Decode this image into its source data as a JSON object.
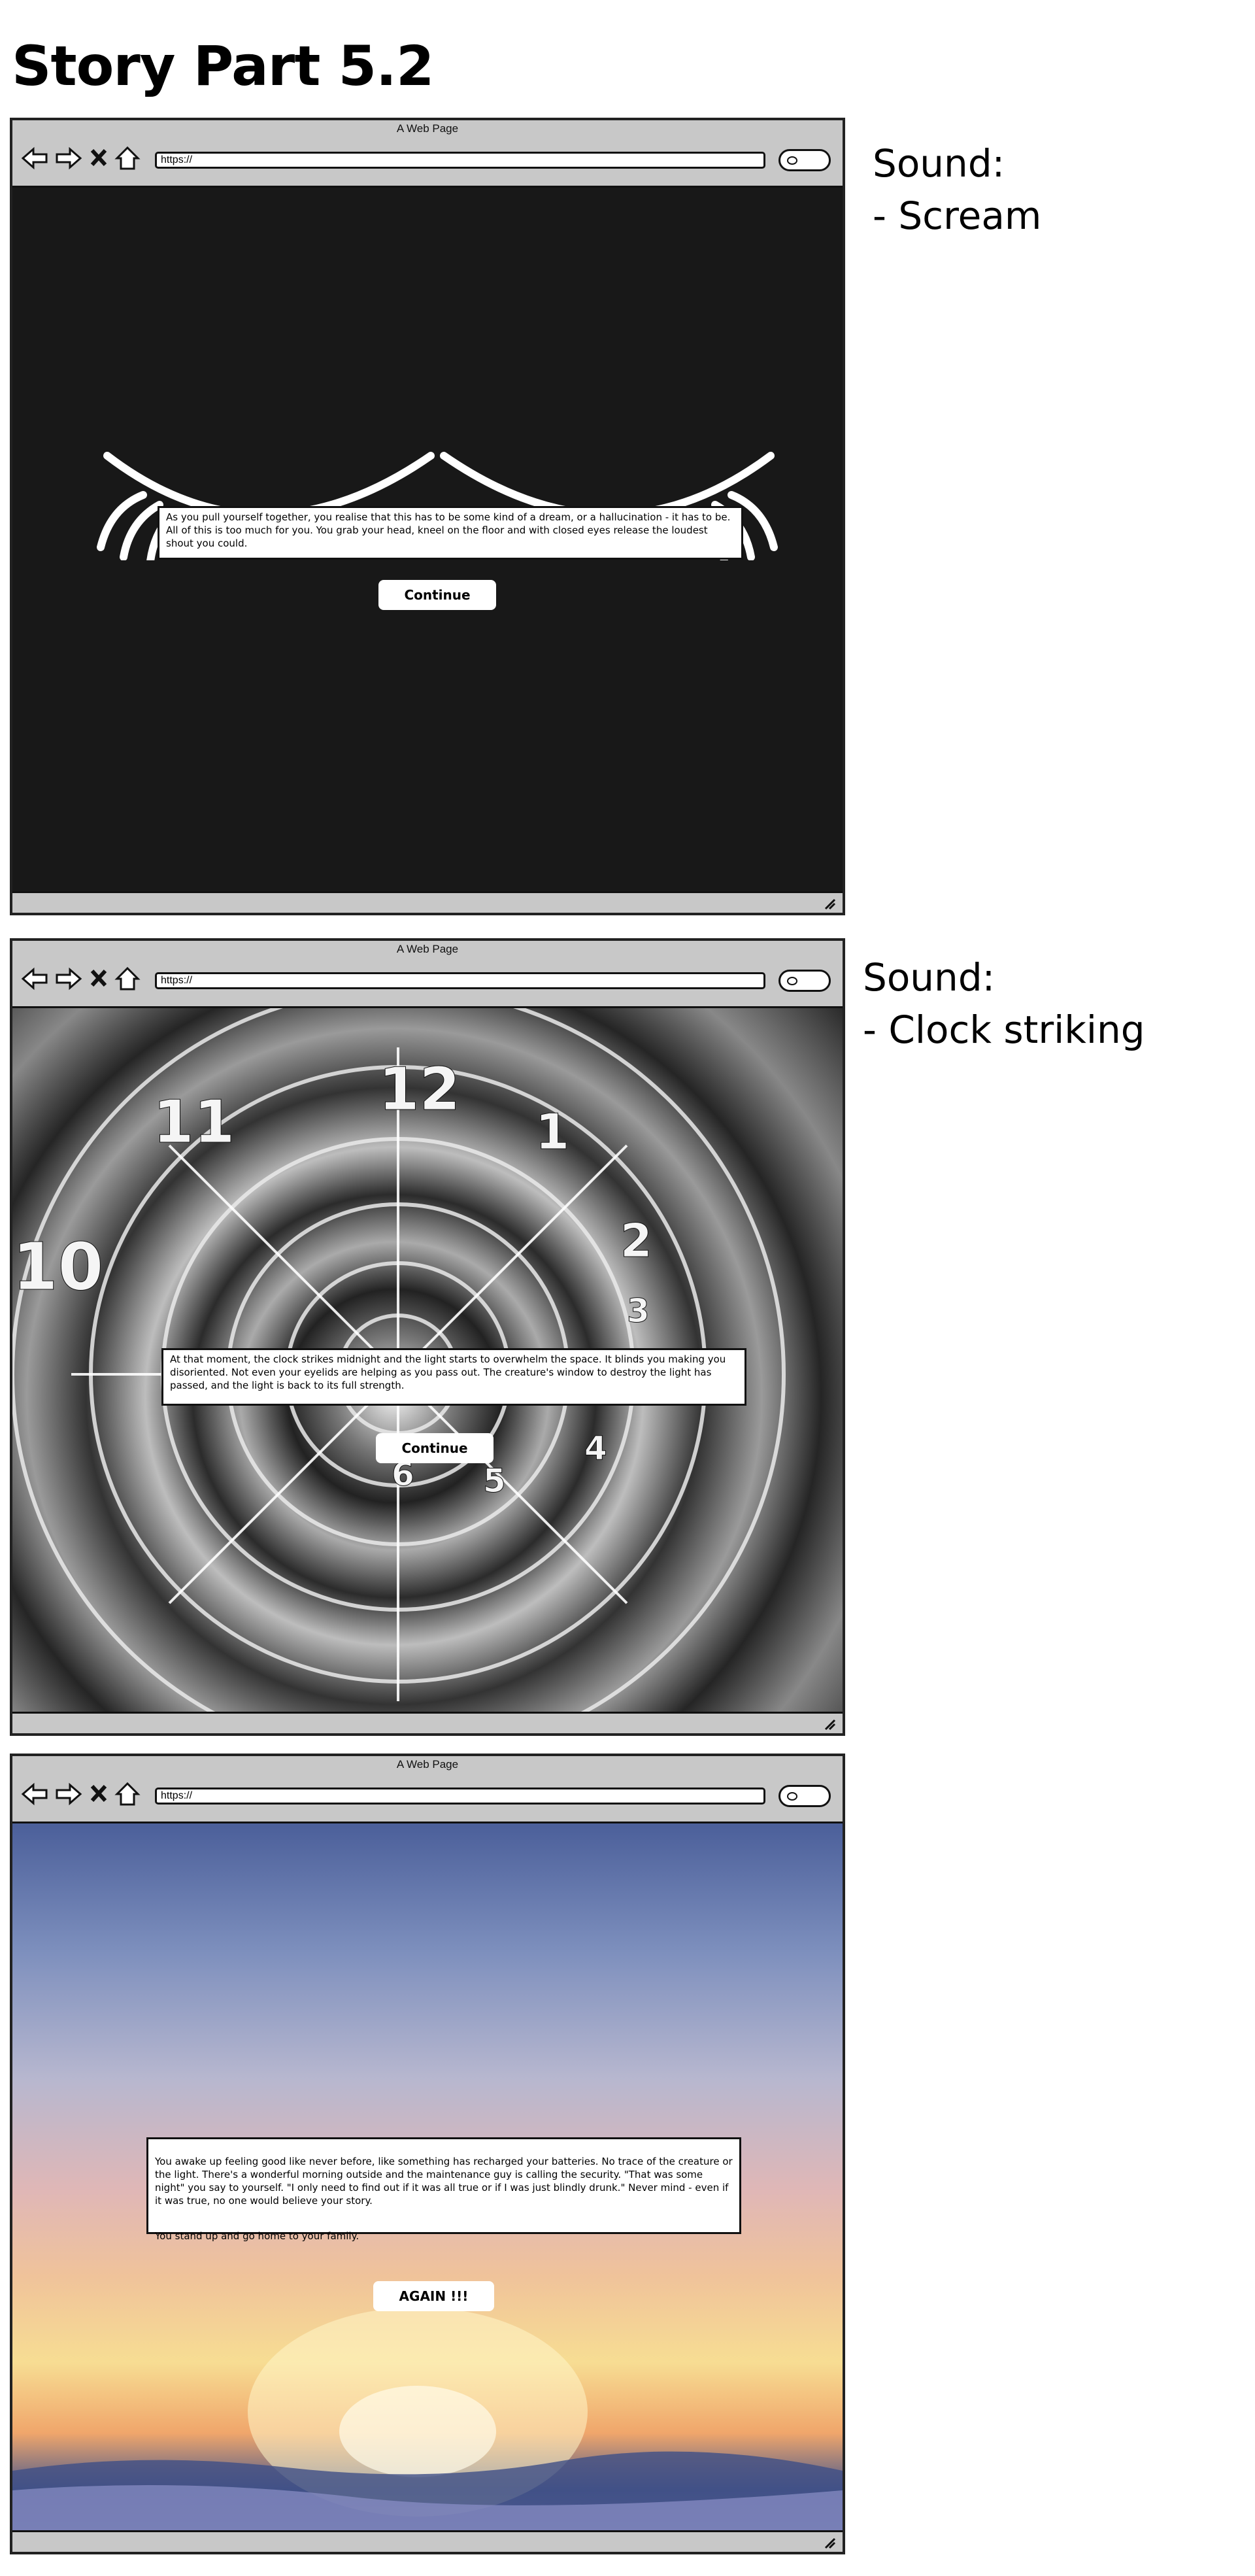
{
  "page": {
    "title": "Story Part 5.2"
  },
  "browser": {
    "window_title": "A Web Page",
    "url": "https://"
  },
  "panels": [
    {
      "sound_label": "Sound:",
      "sound_item": "- Scream",
      "story_text": "As you pull yourself together, you realise that this has to be some kind of a dream, or a hallucination - it has to be. All of this is too much for you. You grab your head, kneel on the floor and with closed eyes release the loudest shout you could.",
      "button_label": "Continue",
      "background": "closed-eyes-illustration"
    },
    {
      "sound_label": "Sound:",
      "sound_item": "- Clock striking",
      "story_text": "At that moment, the clock strikes midnight and the light starts to overwhelm the space. It blinds you making you disoriented. Not even your eyelids are helping as you pass out. The creature's window to destroy the light has passed, and the light is back to its full strength.",
      "button_label": "Continue",
      "background": "spiral-clock-image",
      "clock_numerals": [
        "12",
        "11",
        "1",
        "2",
        "10",
        "3",
        "4",
        "5",
        "6"
      ]
    },
    {
      "story_text": "You awake up feeling good like never before, like something has recharged your batteries. No trace of the creature or the light. There's a wonderful morning outside and the maintenance guy is calling the security. \"That was some night\" you say to yourself. \"I only need to find out if it was all true or if I was just blindly drunk.\" Never mind - even if it was true, no one would believe your story.",
      "story_text_2": "You stand up and go home to your family.",
      "button_label": "AGAIN !!!",
      "background": "sunrise-sky-image"
    }
  ],
  "colors": {
    "dark_bg": "#181818",
    "chrome": "#c8c8c8"
  }
}
